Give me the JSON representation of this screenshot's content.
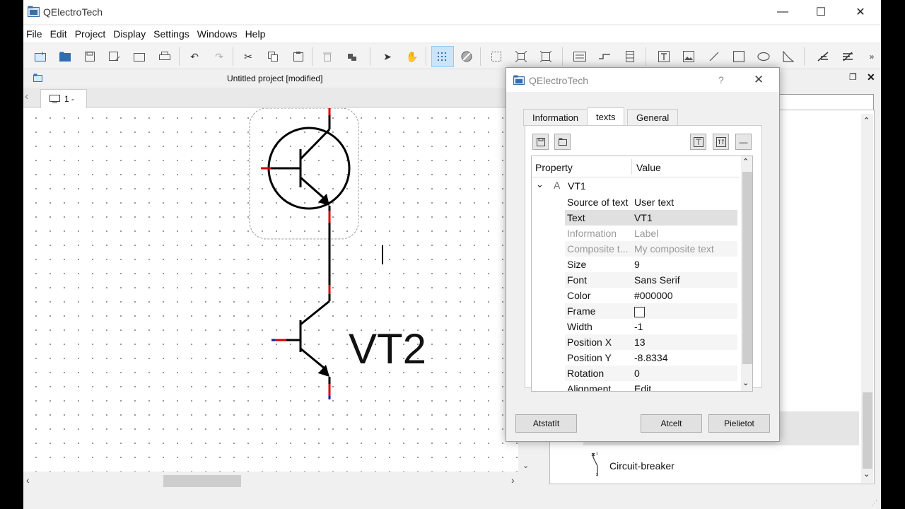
{
  "app": {
    "title": "QElectroTech"
  },
  "menu": [
    "File",
    "Edit",
    "Project",
    "Display",
    "Settings",
    "Windows",
    "Help"
  ],
  "document": {
    "title": "Untitled project [modified]",
    "folio_tab": "1 -"
  },
  "canvas": {
    "element_label": "VT2"
  },
  "collection": {
    "item_label": "Circuit-breaker"
  },
  "dialog": {
    "title": "QElectroTech",
    "help": "?",
    "tabs": [
      "Information",
      "texts",
      "General"
    ],
    "active_tab": "texts",
    "table": {
      "col_property": "Property",
      "col_value": "Value",
      "group": "VT1",
      "rows": [
        {
          "key": "Source of text",
          "value": "User text"
        },
        {
          "key": "Text",
          "value": "VT1"
        },
        {
          "key": "Information",
          "value": "Label"
        },
        {
          "key": "Composite t...",
          "value": "My composite text"
        },
        {
          "key": "Size",
          "value": "9"
        },
        {
          "key": "Font",
          "value": "Sans Serif"
        },
        {
          "key": "Color",
          "value": "#000000"
        },
        {
          "key": "Frame",
          "value": ""
        },
        {
          "key": "Width",
          "value": "-1"
        },
        {
          "key": "Position X",
          "value": "13"
        },
        {
          "key": "Position Y",
          "value": "-8.8334"
        },
        {
          "key": "Rotation",
          "value": "0"
        },
        {
          "key": "Alignment",
          "value": "Edit"
        }
      ]
    },
    "buttons": {
      "reset": "Atstatīt",
      "cancel": "Atcelt",
      "apply": "Pielietot"
    }
  }
}
